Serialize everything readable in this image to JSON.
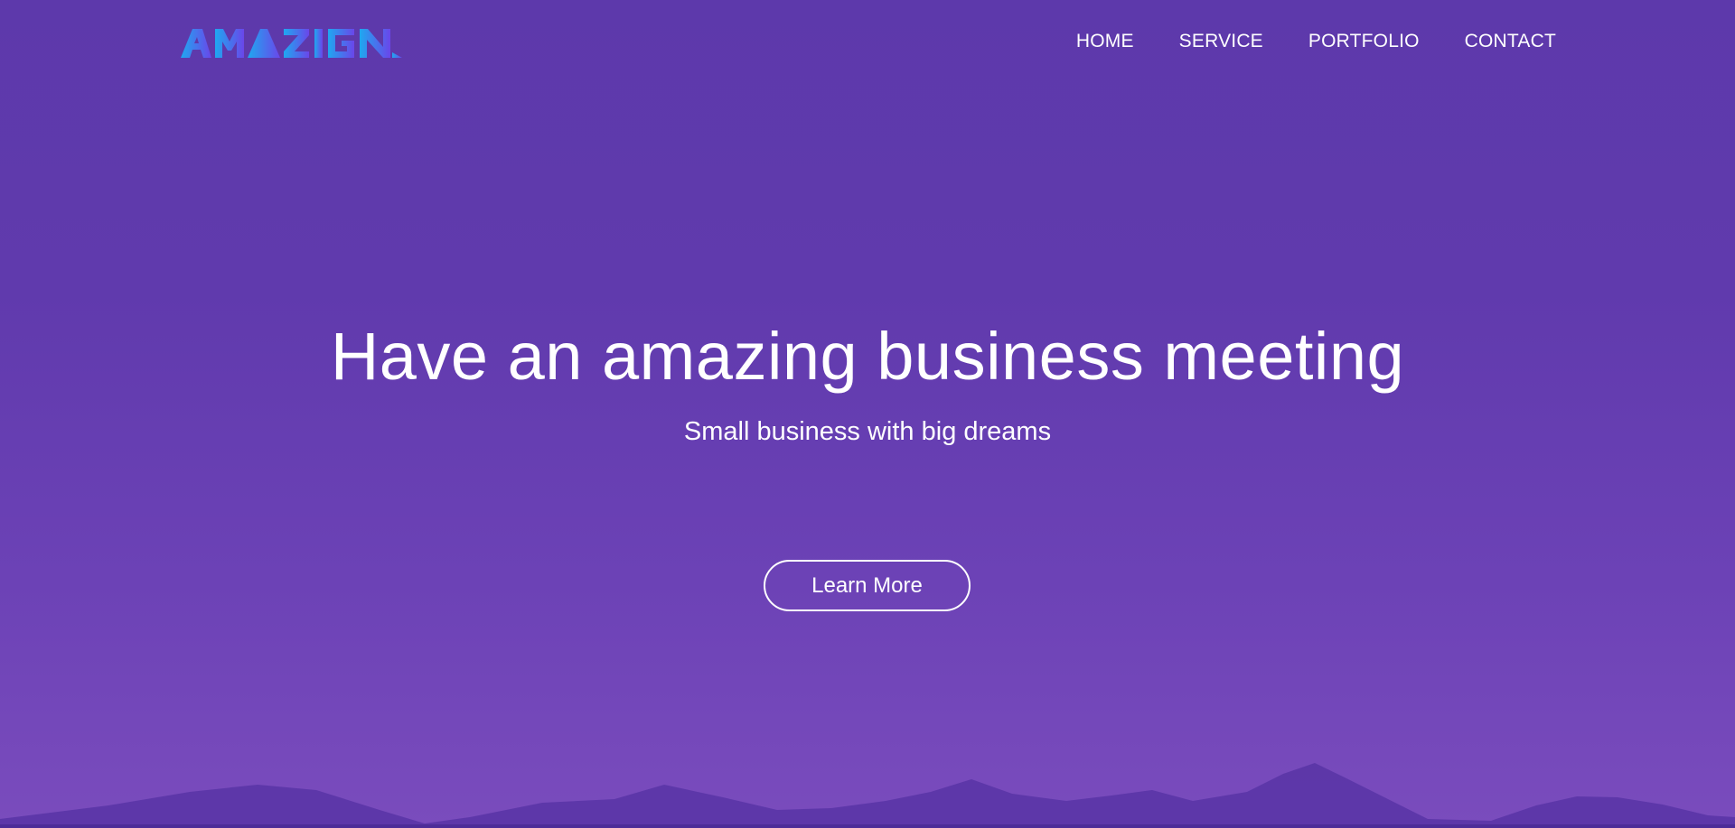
{
  "brand": {
    "logo_text": "AMAZIGN",
    "logo_icon": "amazign-wordmark-logo",
    "gradient_start": "#1fa8f0",
    "gradient_end": "#6a46ea"
  },
  "nav": {
    "items": [
      {
        "label": "HOME"
      },
      {
        "label": "SERVICE"
      },
      {
        "label": "PORTFOLIO"
      },
      {
        "label": "CONTACT"
      }
    ]
  },
  "hero": {
    "title": "Have an amazing business meeting",
    "subtitle": "Small business with big dreams",
    "cta_label": "Learn More",
    "background_color": "#603aad",
    "mountain_color": "#5a35a6"
  }
}
